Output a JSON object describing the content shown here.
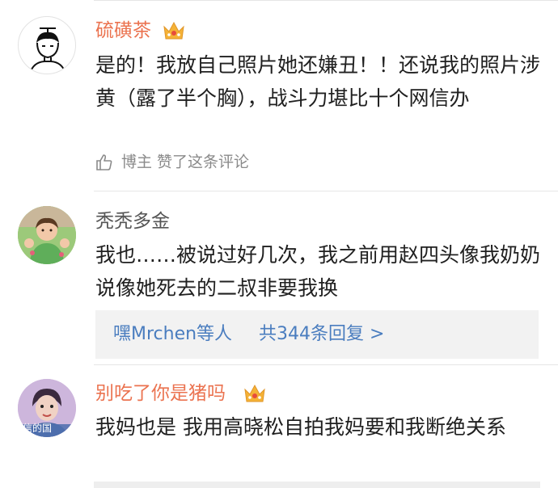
{
  "comments": [
    {
      "username": "硫磺茶",
      "vip": true,
      "avatar_icon": "line-art-person-avatar",
      "text": "是的！我放自己照片她还嫌丑！！还说我的照片涉黄（露了半个胸），战斗力堪比十个网信办",
      "liked_label": "博主 赞了这条评论"
    },
    {
      "username": "秃秃多金",
      "vip": false,
      "avatar_icon": "child-photo-avatar",
      "text": "我也……被说过好几次，我之前用赵四头像我奶奶说像她死去的二叔非要我换",
      "replies": {
        "names": "嘿Mrchen等人",
        "count": "共344条回复 >"
      }
    },
    {
      "username": "别吃了你是猪吗",
      "vip": true,
      "avatar_icon": "person-photo-avatar",
      "avatar_caption": "信的国",
      "text": "我妈也是 我用高晓松自拍我妈要和我断绝关系"
    }
  ],
  "colors": {
    "vip_name": "#eb7350",
    "link": "#4a7dbf",
    "reply_bg": "#f2f2f2",
    "crown_gold": "#f5b236"
  }
}
